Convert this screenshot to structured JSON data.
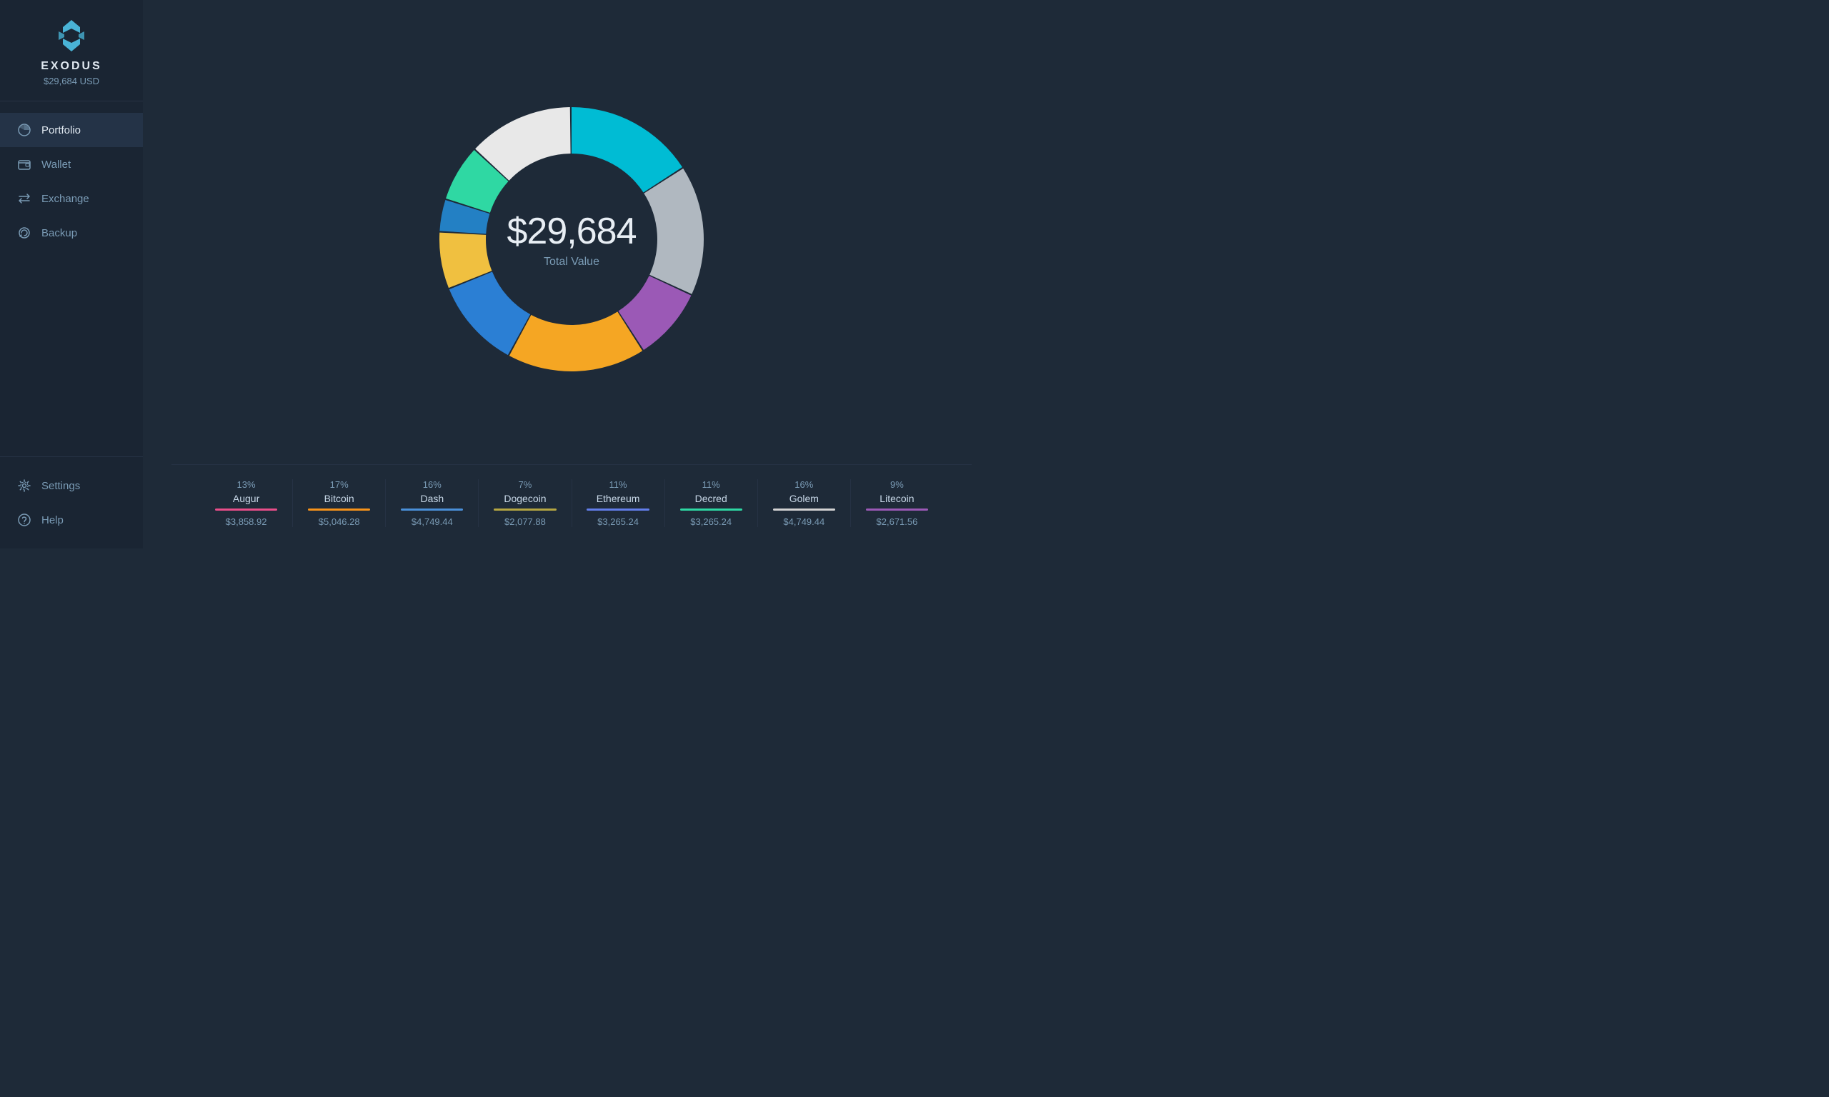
{
  "app": {
    "name": "EXODUS",
    "total_usd": "$29,684 USD"
  },
  "sidebar": {
    "nav_items": [
      {
        "id": "portfolio",
        "label": "Portfolio",
        "active": true
      },
      {
        "id": "wallet",
        "label": "Wallet",
        "active": false
      },
      {
        "id": "exchange",
        "label": "Exchange",
        "active": false
      },
      {
        "id": "backup",
        "label": "Backup",
        "active": false
      }
    ],
    "bottom_items": [
      {
        "id": "settings",
        "label": "Settings"
      },
      {
        "id": "help",
        "label": "Help"
      }
    ]
  },
  "chart": {
    "center_amount": "$29,684",
    "center_label": "Total Value"
  },
  "legend": [
    {
      "id": "augur",
      "name": "Augur",
      "percent": "13%",
      "value": "$3,858.92",
      "color": "#e94e8a"
    },
    {
      "id": "bitcoin",
      "name": "Bitcoin",
      "percent": "17%",
      "value": "$5,046.28",
      "color": "#f7931a"
    },
    {
      "id": "dash",
      "name": "Dash",
      "percent": "16%",
      "value": "$4,749.44",
      "color": "#4a90d9"
    },
    {
      "id": "dogecoin",
      "name": "Dogecoin",
      "percent": "7%",
      "value": "$2,077.88",
      "color": "#b5a642"
    },
    {
      "id": "ethereum",
      "name": "Ethereum",
      "percent": "11%",
      "value": "$3,265.24",
      "color": "#627eea"
    },
    {
      "id": "decred",
      "name": "Decred",
      "percent": "11%",
      "value": "$3,265.24",
      "color": "#2ed8a3"
    },
    {
      "id": "golem",
      "name": "Golem",
      "percent": "16%",
      "value": "$4,749.44",
      "color": "#d3d3d3"
    },
    {
      "id": "litecoin",
      "name": "Litecoin",
      "percent": "9%",
      "value": "$2,671.56",
      "color": "#9b59b6"
    }
  ],
  "donut_segments": [
    {
      "name": "Ethereum",
      "percent": 11,
      "color": "#2fd8a3"
    },
    {
      "name": "Dash",
      "percent": 16,
      "color": "#00bcd4"
    },
    {
      "name": "Golem",
      "percent": 16,
      "color": "#b0b8c0"
    },
    {
      "name": "Litecoin",
      "percent": 9,
      "color": "#9b59b6"
    },
    {
      "name": "Bitcoin",
      "percent": 17,
      "color": "#f5a623"
    },
    {
      "name": "Decred",
      "percent": 11,
      "color": "#2b7fd4"
    },
    {
      "name": "Dogecoin",
      "percent": 7,
      "color": "#f0c040"
    },
    {
      "name": "Augur",
      "percent": 13,
      "color": "#f0f0f0"
    }
  ]
}
